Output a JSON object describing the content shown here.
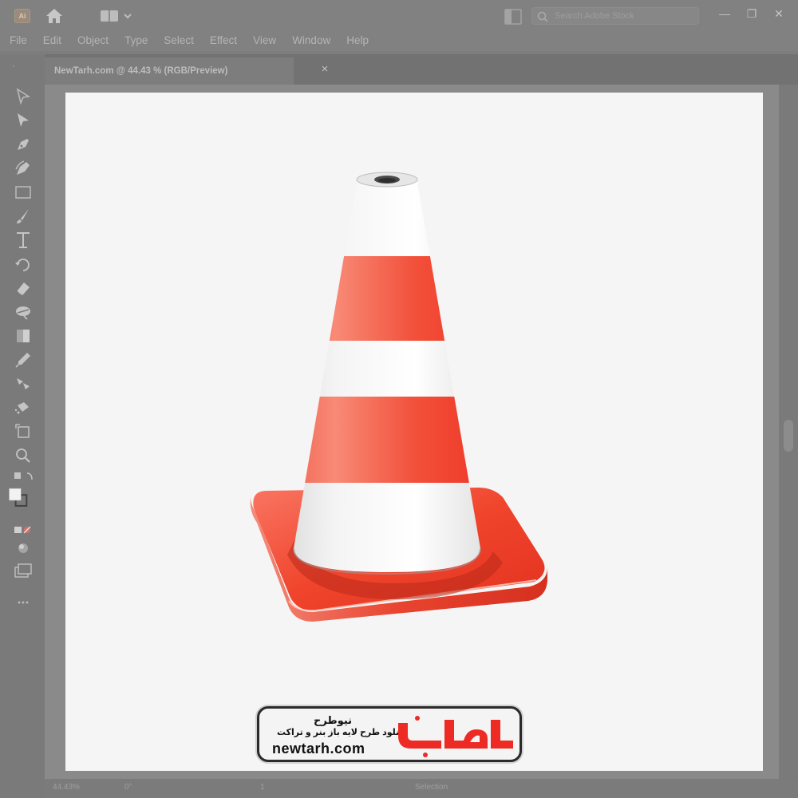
{
  "app": {
    "logo_text": "Ai",
    "search_placeholder": "Search Adobe Stock"
  },
  "menu": [
    "File",
    "Edit",
    "Object",
    "Type",
    "Select",
    "Effect",
    "View",
    "Window",
    "Help"
  ],
  "document_tab": {
    "title": "NewTarh.com @ 44.43 % (RGB/Preview)",
    "close_glyph": "×"
  },
  "status": {
    "zoom": "44.43%",
    "rotation": "0°",
    "artboard_number": "1",
    "mode": "Selection"
  },
  "watermark": {
    "title": "نیوطرح",
    "tagline": "دانلود طرح لایه باز بنر و تراکت",
    "url": "newtarh.com",
    "logo_text": "نیوطرح"
  },
  "colors": {
    "cone_orange": "#f0442c",
    "cone_white": "#f2f2f2",
    "logo_red": "#ee2a24"
  },
  "window_controls": [
    "—",
    "❐",
    "✕"
  ]
}
